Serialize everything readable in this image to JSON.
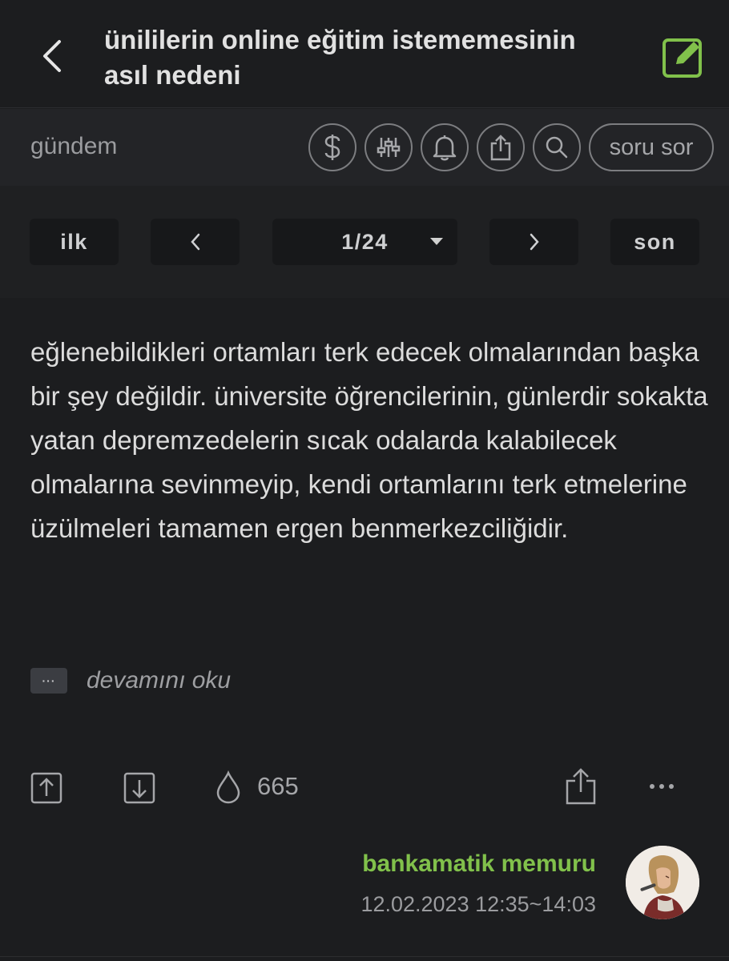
{
  "header": {
    "title": "ünililerin online eğitim istememesinin asıl nedeni",
    "back_icon": "chevron-left-icon",
    "edit_icon": "edit-icon",
    "accent_color": "#81c14b"
  },
  "channel_bar": {
    "channel": "gündem",
    "actions": [
      {
        "name": "dollar-icon"
      },
      {
        "name": "sliders-icon"
      },
      {
        "name": "bell-icon"
      },
      {
        "name": "share-icon"
      },
      {
        "name": "search-icon"
      }
    ],
    "ask_label": "soru sor"
  },
  "pager": {
    "first": "ilk",
    "last": "son",
    "current": "1/24",
    "prev_icon": "chevron-left-icon",
    "next_icon": "chevron-right-icon"
  },
  "entry": {
    "text": "eğlenebildikleri ortamları terk edecek olmalarından başka bir şey değildir. üniversite öğrencilerinin, günlerdir sokakta yatan depremzedelerin sıcak odalarda kalabilecek olmalarına sevinmeyip, kendi ortamlarını terk etmelerine üzülmeleri tamamen ergen benmerkezciliğidir.",
    "more_badge": "···",
    "read_more": "devamını oku",
    "fav_count": "665"
  },
  "author": {
    "name": "bankamatik memuru",
    "date": "12.02.2023 12:35~14:03"
  }
}
